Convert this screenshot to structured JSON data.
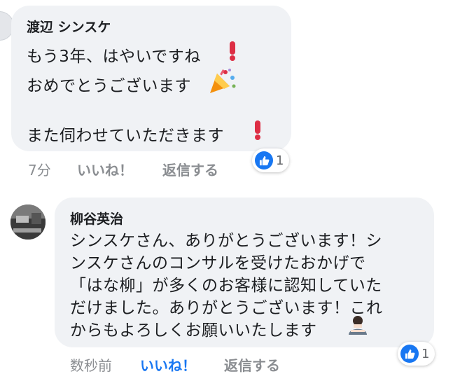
{
  "comment1": {
    "author": "渡辺 シンスケ",
    "lines": [
      "もう3年、はやいですね",
      "おめでとうございます",
      "",
      "また伺わせていただきます"
    ],
    "time": "7分",
    "like_label": "いいね！",
    "reply_label": "返信する",
    "reaction_count": "1"
  },
  "comment2": {
    "author": "柳谷英治",
    "lines": [
      "シンスケさん、ありがとうございます！シ",
      "ンスケさんのコンサルを受けたおかげで",
      "「はな柳」が多くのお客様に認知していた",
      "だけました。ありがとうございます！これ",
      "からもよろしくお願いいたします"
    ],
    "time": "数秒前",
    "like_label": "いいね！",
    "reply_label": "返信する",
    "reaction_count": "1"
  },
  "icons": {
    "exclamation": "red-exclamation-icon",
    "party": "party-popper-icon",
    "bow": "bowing-person-icon",
    "like": "thumbs-up-icon"
  },
  "colors": {
    "bubble": "#f0f2f5",
    "liked": "#1877f2",
    "meta": "#8a8d91",
    "text": "#1c1e21"
  }
}
